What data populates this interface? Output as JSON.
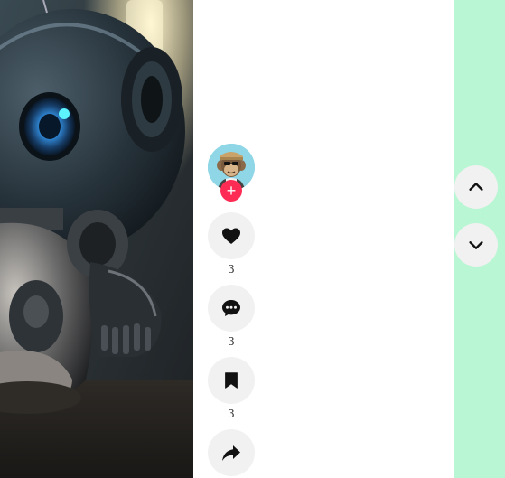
{
  "media": {
    "description_icon": "robot-video-frame"
  },
  "author": {
    "follow_symbol": "+"
  },
  "actions": {
    "like": {
      "icon": "heart-icon",
      "count": "3"
    },
    "comment": {
      "icon": "comment-icon",
      "count": "3"
    },
    "save": {
      "icon": "bookmark-icon",
      "count": "3"
    },
    "share": {
      "icon": "share-icon"
    }
  },
  "navigation": {
    "up_icon": "chevron-up-icon",
    "down_icon": "chevron-down-icon"
  },
  "colors": {
    "nav_strip": "#b9f6d3",
    "button_bg": "#f1f1f1",
    "follow_bg": "#fe2c55",
    "avatar_bg": "#8fd6e6"
  }
}
